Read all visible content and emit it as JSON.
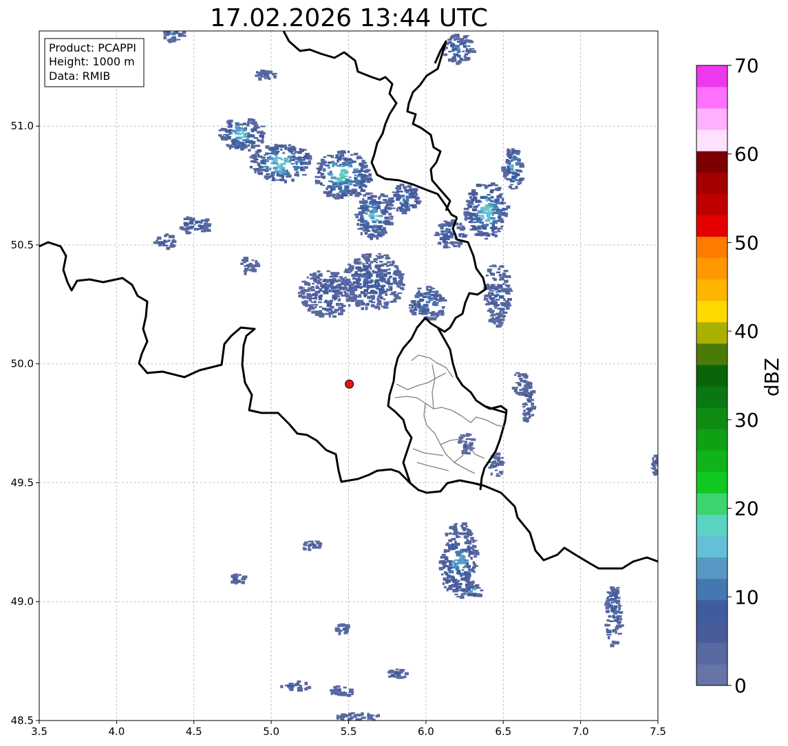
{
  "title": "17.02.2026 13:44 UTC",
  "info_box": {
    "product": "Product: PCAPPI",
    "height": "Height: 1000 m",
    "data": "Data: RMIB"
  },
  "map_extent": {
    "lon": [
      3.5,
      7.5
    ],
    "lat": [
      48.5,
      51.4
    ]
  },
  "x_ticks": [
    "3.5",
    "4.0",
    "4.5",
    "5.0",
    "5.5",
    "6.0",
    "6.5",
    "7.0",
    "7.5"
  ],
  "y_ticks": [
    "48.5",
    "49.0",
    "49.5",
    "50.0",
    "50.5",
    "51.0"
  ],
  "radar_site": {
    "lon": 5.505,
    "lat": 49.915,
    "color": "#ee1111"
  },
  "colorbar": {
    "unit": "dBZ",
    "range": [
      0,
      70
    ],
    "tick_labels": [
      "0",
      "10",
      "20",
      "30",
      "40",
      "50",
      "60",
      "70"
    ],
    "colors": [
      "#6674a6",
      "#5868a0",
      "#485c9c",
      "#405ca0",
      "#4478b0",
      "#5898c4",
      "#64c0d8",
      "#5ad4c0",
      "#3cd46c",
      "#10c820",
      "#10b418",
      "#10a014",
      "#0e8c12",
      "#0a7810",
      "#0a640c",
      "#4a7a08",
      "#aab000",
      "#ffd800",
      "#ffb400",
      "#ff9800",
      "#ff7c00",
      "#e40000",
      "#c00000",
      "#a40000",
      "#7c0000",
      "#ffe0ff",
      "#ffb0ff",
      "#ff70ff",
      "#ee38ee"
    ]
  },
  "precip_cells": [
    {
      "lon": 5.35,
      "lat": 50.3,
      "r": [
        0.18,
        0.1
      ],
      "max_dbz": 12
    },
    {
      "lon": 5.65,
      "lat": 50.35,
      "r": [
        0.2,
        0.12
      ],
      "max_dbz": 14
    },
    {
      "lon": 6.0,
      "lat": 50.26,
      "r": [
        0.12,
        0.07
      ],
      "max_dbz": 16
    },
    {
      "lon": 6.45,
      "lat": 50.3,
      "r": [
        0.08,
        0.14
      ],
      "max_dbz": 12
    },
    {
      "lon": 5.05,
      "lat": 50.85,
      "r": [
        0.2,
        0.08
      ],
      "max_dbz": 22
    },
    {
      "lon": 5.45,
      "lat": 50.8,
      "r": [
        0.18,
        0.1
      ],
      "max_dbz": 22
    },
    {
      "lon": 4.8,
      "lat": 50.97,
      "r": [
        0.15,
        0.07
      ],
      "max_dbz": 20
    },
    {
      "lon": 5.65,
      "lat": 50.63,
      "r": [
        0.12,
        0.1
      ],
      "max_dbz": 20
    },
    {
      "lon": 5.85,
      "lat": 50.7,
      "r": [
        0.1,
        0.06
      ],
      "max_dbz": 16
    },
    {
      "lon": 6.38,
      "lat": 50.65,
      "r": [
        0.14,
        0.12
      ],
      "max_dbz": 22
    },
    {
      "lon": 6.15,
      "lat": 50.55,
      "r": [
        0.1,
        0.06
      ],
      "max_dbz": 16
    },
    {
      "lon": 6.55,
      "lat": 50.83,
      "r": [
        0.07,
        0.09
      ],
      "max_dbz": 18
    },
    {
      "lon": 4.5,
      "lat": 50.59,
      "r": [
        0.1,
        0.04
      ],
      "max_dbz": 14
    },
    {
      "lon": 4.3,
      "lat": 50.52,
      "r": [
        0.07,
        0.03
      ],
      "max_dbz": 10
    },
    {
      "lon": 4.85,
      "lat": 50.42,
      "r": [
        0.05,
        0.04
      ],
      "max_dbz": 10
    },
    {
      "lon": 6.2,
      "lat": 51.33,
      "r": [
        0.1,
        0.06
      ],
      "max_dbz": 16
    },
    {
      "lon": 4.35,
      "lat": 51.39,
      "r": [
        0.08,
        0.03
      ],
      "max_dbz": 12
    },
    {
      "lon": 4.95,
      "lat": 51.22,
      "r": [
        0.07,
        0.02
      ],
      "max_dbz": 10
    },
    {
      "lon": 6.2,
      "lat": 49.18,
      "r": [
        0.12,
        0.16
      ],
      "max_dbz": 18
    },
    {
      "lon": 6.3,
      "lat": 49.05,
      "r": [
        0.06,
        0.03
      ],
      "max_dbz": 20
    },
    {
      "lon": 7.2,
      "lat": 48.95,
      "r": [
        0.05,
        0.14
      ],
      "max_dbz": 14
    },
    {
      "lon": 6.6,
      "lat": 49.92,
      "r": [
        0.05,
        0.05
      ],
      "max_dbz": 10
    },
    {
      "lon": 6.65,
      "lat": 49.85,
      "r": [
        0.04,
        0.1
      ],
      "max_dbz": 12
    },
    {
      "lon": 6.25,
      "lat": 49.67,
      "r": [
        0.05,
        0.05
      ],
      "max_dbz": 10
    },
    {
      "lon": 6.45,
      "lat": 49.58,
      "r": [
        0.05,
        0.05
      ],
      "max_dbz": 10
    },
    {
      "lon": 5.25,
      "lat": 49.24,
      "r": [
        0.06,
        0.02
      ],
      "max_dbz": 10
    },
    {
      "lon": 4.77,
      "lat": 49.1,
      "r": [
        0.05,
        0.02
      ],
      "max_dbz": 10
    },
    {
      "lon": 5.45,
      "lat": 48.89,
      "r": [
        0.04,
        0.02
      ],
      "max_dbz": 10
    },
    {
      "lon": 5.15,
      "lat": 48.65,
      "r": [
        0.1,
        0.02
      ],
      "max_dbz": 12
    },
    {
      "lon": 5.45,
      "lat": 48.63,
      "r": [
        0.08,
        0.02
      ],
      "max_dbz": 10
    },
    {
      "lon": 5.8,
      "lat": 48.7,
      "r": [
        0.07,
        0.02
      ],
      "max_dbz": 10
    },
    {
      "lon": 5.55,
      "lat": 48.52,
      "r": [
        0.15,
        0.02
      ],
      "max_dbz": 8
    },
    {
      "lon": 7.48,
      "lat": 49.58,
      "r": [
        0.03,
        0.05
      ],
      "max_dbz": 10
    }
  ]
}
